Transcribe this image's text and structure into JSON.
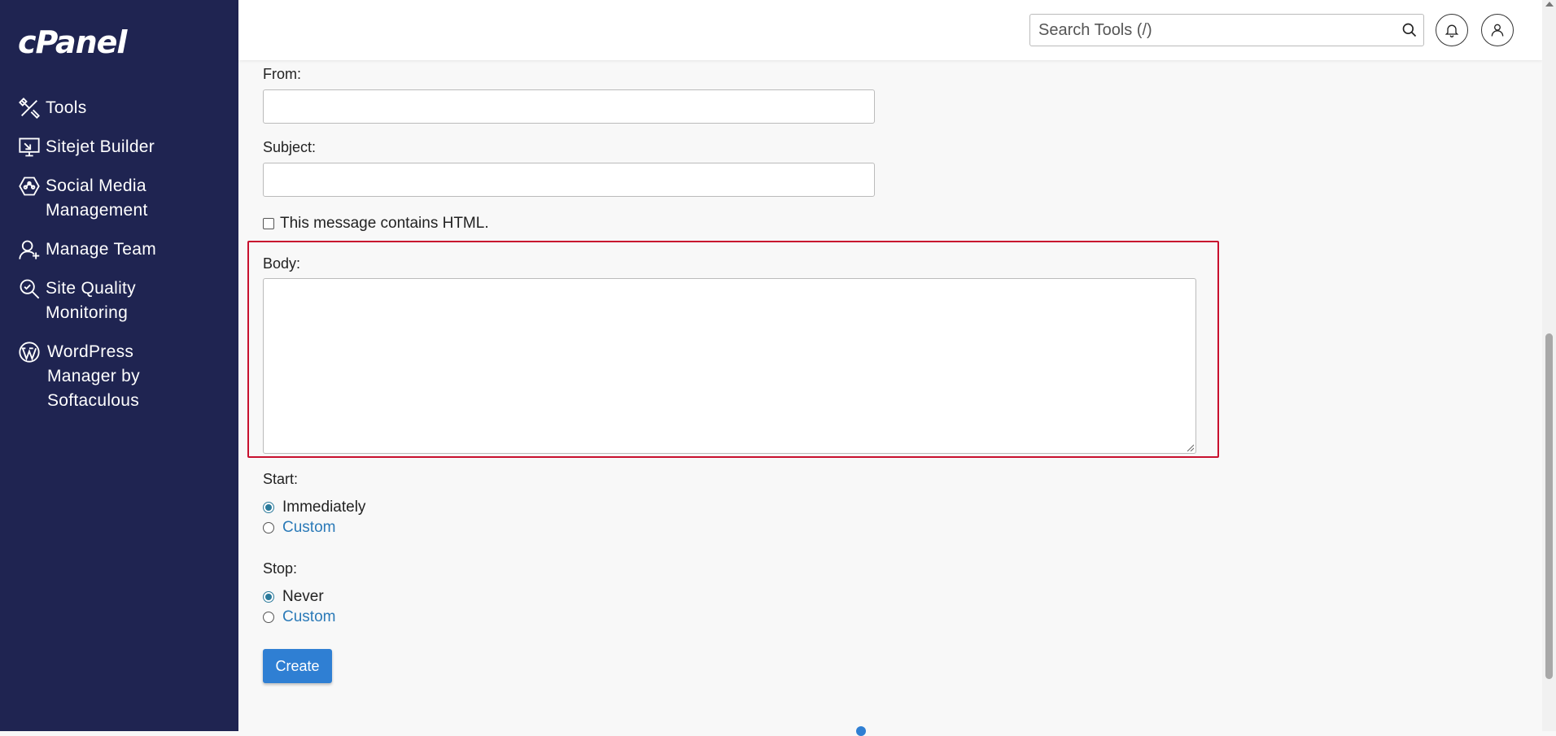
{
  "brand": {
    "logo_text": "cPanel"
  },
  "sidebar": {
    "items": [
      {
        "label": "Tools",
        "icon": "tools-icon"
      },
      {
        "label": "Sitejet Builder",
        "icon": "sitejet-icon"
      },
      {
        "label": "Social Media\nManagement",
        "icon": "social-media-icon"
      },
      {
        "label": "Manage Team",
        "icon": "manage-team-icon"
      },
      {
        "label": "Site Quality\nMonitoring",
        "icon": "site-quality-icon"
      },
      {
        "label": "WordPress\nManager by\nSoftaculous",
        "icon": "wordpress-icon"
      }
    ]
  },
  "header": {
    "search_placeholder": "Search Tools (/)"
  },
  "form": {
    "from_label": "From:",
    "subject_label": "Subject:",
    "html_checkbox_label": "This message contains HTML.",
    "body_label": "Body:",
    "start_label": "Start:",
    "start_options": [
      "Immediately",
      "Custom"
    ],
    "stop_label": "Stop:",
    "stop_options": [
      "Never",
      "Custom"
    ],
    "create_button": "Create"
  },
  "colors": {
    "sidebar_bg": "#1f2451",
    "highlight": "#c8102e",
    "accent": "#2f7fd3"
  }
}
